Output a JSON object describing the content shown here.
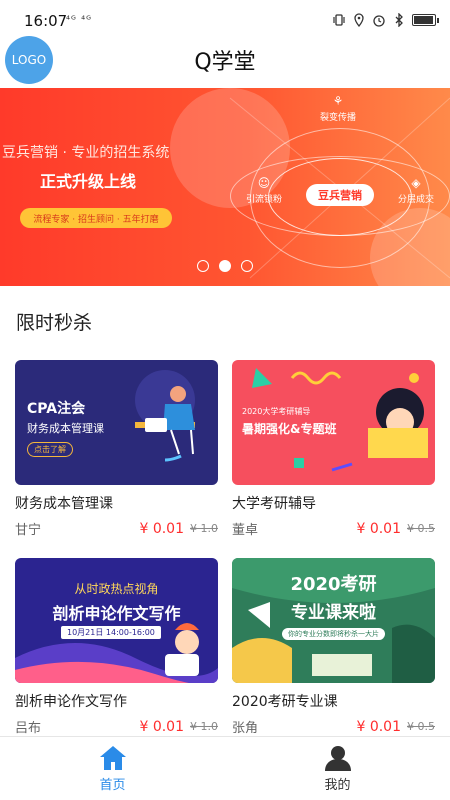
{
  "status": {
    "time": "16:07",
    "network": "⁴ᴳ ⁴ᴳ",
    "battery_level": 0.85
  },
  "header": {
    "logo": "LOGO",
    "title": "Q学堂"
  },
  "banner": {
    "subtitle": "豆兵营销 · 专业的招生系统",
    "headline": "正式升级上线",
    "tag": "流程专家 · 招生顾问 · 五年打磨",
    "brand": "豆兵营销",
    "nodes": [
      "裂变传播",
      "引流锁粉",
      "分层成交"
    ],
    "slide_count": 3,
    "active_slide": 1
  },
  "flash_sale": {
    "title": "限时秒杀",
    "courses": [
      {
        "name": "财务成本管理课",
        "teacher": "甘宁",
        "price": "¥ 0.01",
        "original_price": "¥ 1.0",
        "poster": {
          "line1": "CPA注会",
          "line2": "财务成本管理课",
          "button": "点击了解"
        }
      },
      {
        "name": "大学考研辅导",
        "teacher": "董卓",
        "price": "¥ 0.01",
        "original_price": "¥ 0.5",
        "poster": {
          "line1": "2020大学考研辅导",
          "line2": "暑期强化&专题班"
        }
      },
      {
        "name": "剖析申论作文写作",
        "teacher": "吕布",
        "price": "¥ 0.01",
        "original_price": "¥ 1.0",
        "poster": {
          "line1": "从时政热点视角",
          "line2": "剖析申论作文写作",
          "date": "10月21日 14:00-16:00"
        }
      },
      {
        "name": "2020考研专业课",
        "teacher": "张角",
        "price": "¥ 0.01",
        "original_price": "¥ 0.5",
        "poster": {
          "line1": "2020考研",
          "line2": "专业课来啦",
          "line3": "你的专业分数即将秒杀一大片"
        }
      }
    ]
  },
  "tabbar": {
    "tabs": [
      {
        "label": "首页",
        "icon": "home-icon",
        "active": true
      },
      {
        "label": "我的",
        "icon": "profile-icon",
        "active": false
      }
    ],
    "active_color": "#2a8be8"
  }
}
